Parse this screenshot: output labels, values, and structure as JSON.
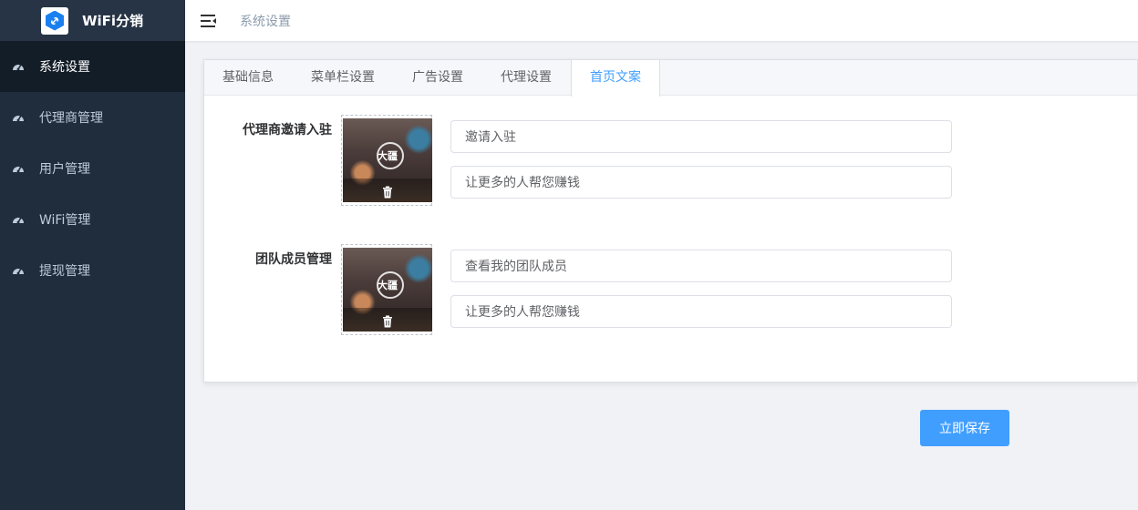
{
  "app": {
    "name": "WiFi分销",
    "logo_icon": "link-icon"
  },
  "sidebar": {
    "items": [
      {
        "label": "系统设置",
        "icon": "dashboard-icon",
        "active": true
      },
      {
        "label": "代理商管理",
        "icon": "dashboard-icon",
        "active": false
      },
      {
        "label": "用户管理",
        "icon": "dashboard-icon",
        "active": false
      },
      {
        "label": "WiFi管理",
        "icon": "dashboard-icon",
        "active": false
      },
      {
        "label": "提现管理",
        "icon": "dashboard-icon",
        "active": false
      }
    ]
  },
  "header": {
    "breadcrumb": "系统设置",
    "menu_icon": "hamburger-icon"
  },
  "tabs": [
    {
      "label": "基础信息",
      "active": false
    },
    {
      "label": "菜单栏设置",
      "active": false
    },
    {
      "label": "广告设置",
      "active": false
    },
    {
      "label": "代理设置",
      "active": false
    },
    {
      "label": "首页文案",
      "active": true
    }
  ],
  "form": {
    "rows": [
      {
        "label": "代理商邀请入驻",
        "image_mark": "大疆",
        "title_value": "邀请入驻",
        "subtitle_value": "让更多的人帮您赚钱"
      },
      {
        "label": "团队成员管理",
        "image_mark": "大疆",
        "title_value": "查看我的团队成员",
        "subtitle_value": "让更多的人帮您赚钱"
      }
    ]
  },
  "actions": {
    "save_label": "立即保存"
  },
  "colors": {
    "sidebar_bg": "#1f2d3d",
    "sidebar_active_bg": "#131d28",
    "accent": "#409eff",
    "brand_blue": "#1a80f0"
  }
}
